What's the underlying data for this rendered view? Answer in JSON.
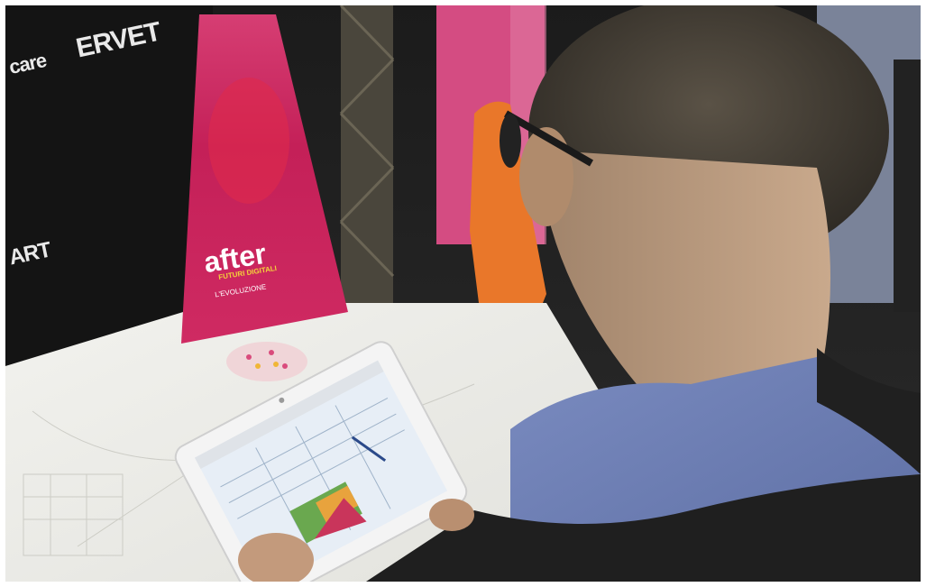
{
  "photo": {
    "banner_logos": [
      "ERVET",
      "care",
      "ART"
    ],
    "standee": {
      "brand": "after",
      "subtitle": "FUTURI DIGITALI",
      "tagline": "L'EVOLUZIONE"
    },
    "colors": {
      "magenta": "#c8225a",
      "pink": "#d7467c",
      "shirt": "#6f7fb2",
      "chair": "#e9772a",
      "table": "#eeeeea",
      "dark": "#1d1d1d"
    }
  }
}
